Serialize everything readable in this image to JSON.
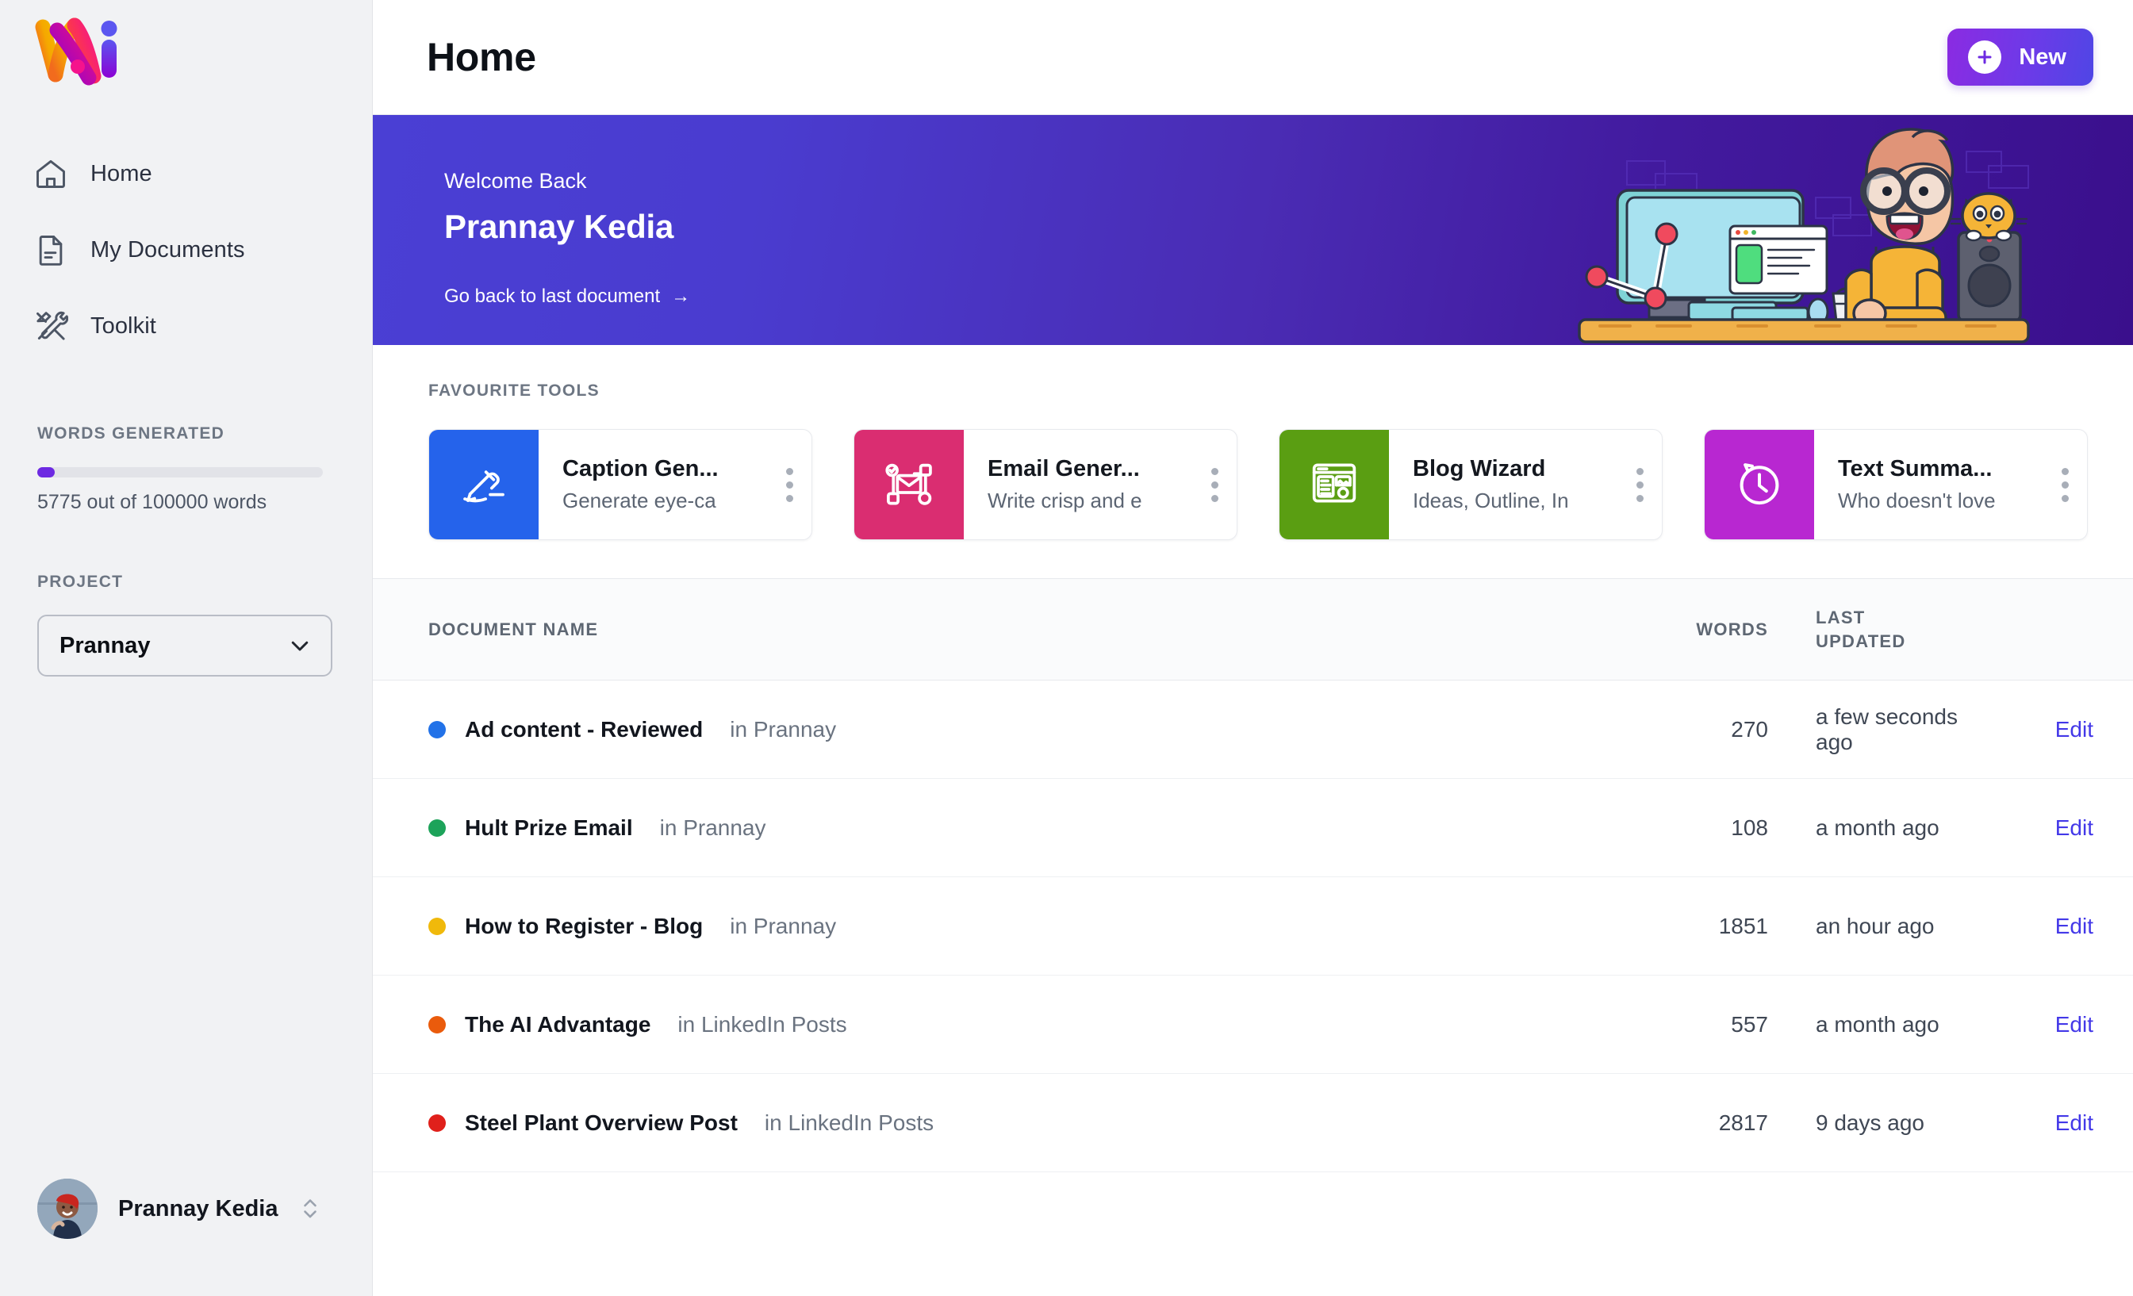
{
  "sidebar": {
    "logo_name": "writesonic-logo",
    "nav": [
      {
        "label": "Home",
        "icon": "home-icon"
      },
      {
        "label": "My Documents",
        "icon": "document-icon"
      },
      {
        "label": "Toolkit",
        "icon": "tools-icon"
      }
    ],
    "words": {
      "heading": "WORDS GENERATED",
      "text": "5775 out of 100000 words",
      "used": 5775,
      "total": 100000,
      "fill_color": "#6d2ae2"
    },
    "project": {
      "heading": "PROJECT",
      "selected": "Prannay",
      "chevron": "chevron-down-icon"
    },
    "user": {
      "name": "Prannay Kedia",
      "toggle": "up-down-chevron-icon"
    }
  },
  "topbar": {
    "title": "Home",
    "new_label": "New",
    "new_icon": "plus-icon"
  },
  "banner": {
    "greeting": "Welcome Back",
    "name": "Prannay Kedia",
    "link": "Go back to last document",
    "link_arrow": "→",
    "gradient_from": "#4a3fd4",
    "gradient_to": "#3a0f8c"
  },
  "tools": {
    "heading": "FAVOURITE TOOLS",
    "items": [
      {
        "title": "Caption Gen...",
        "subtitle": "Generate eye-ca",
        "color": "#2563eb",
        "icon": "pen-writing-icon"
      },
      {
        "title": "Email Gener...",
        "subtitle": "Write crisp and e",
        "color": "#da2d71",
        "icon": "email-flow-icon"
      },
      {
        "title": "Blog Wizard",
        "subtitle": "Ideas, Outline, In",
        "color": "#5a9e12",
        "icon": "blog-layout-icon"
      },
      {
        "title": "Text Summa...",
        "subtitle": "Who doesn't love",
        "color": "#b827d1",
        "icon": "clock-rewind-icon"
      }
    ]
  },
  "documents": {
    "columns": {
      "name": "DOCUMENT NAME",
      "words": "WORDS",
      "updated_line1": "LAST",
      "updated_line2": "UPDATED",
      "action": ""
    },
    "edit_label": "Edit",
    "in_label": "in",
    "rows": [
      {
        "dot": "#2272e8",
        "title": "Ad content - Reviewed",
        "project": "in Prannay",
        "words": "270",
        "updated": "a few seconds ago",
        "edit": "Edit"
      },
      {
        "dot": "#1da35a",
        "title": "Hult Prize Email",
        "project": "in Prannay",
        "words": "108",
        "updated": "a month ago",
        "edit": "Edit"
      },
      {
        "dot": "#f0b90b",
        "title": "How to Register - Blog",
        "project": "in Prannay",
        "words": "1851",
        "updated": "an hour ago",
        "edit": "Edit"
      },
      {
        "dot": "#ea5b0c",
        "title": "The AI Advantage",
        "project": "in LinkedIn Posts",
        "words": "557",
        "updated": "a month ago",
        "edit": "Edit"
      },
      {
        "dot": "#e0201b",
        "title": "Steel Plant Overview Post",
        "project": "in LinkedIn Posts",
        "words": "2817",
        "updated": "9 days ago",
        "edit": "Edit"
      }
    ]
  }
}
